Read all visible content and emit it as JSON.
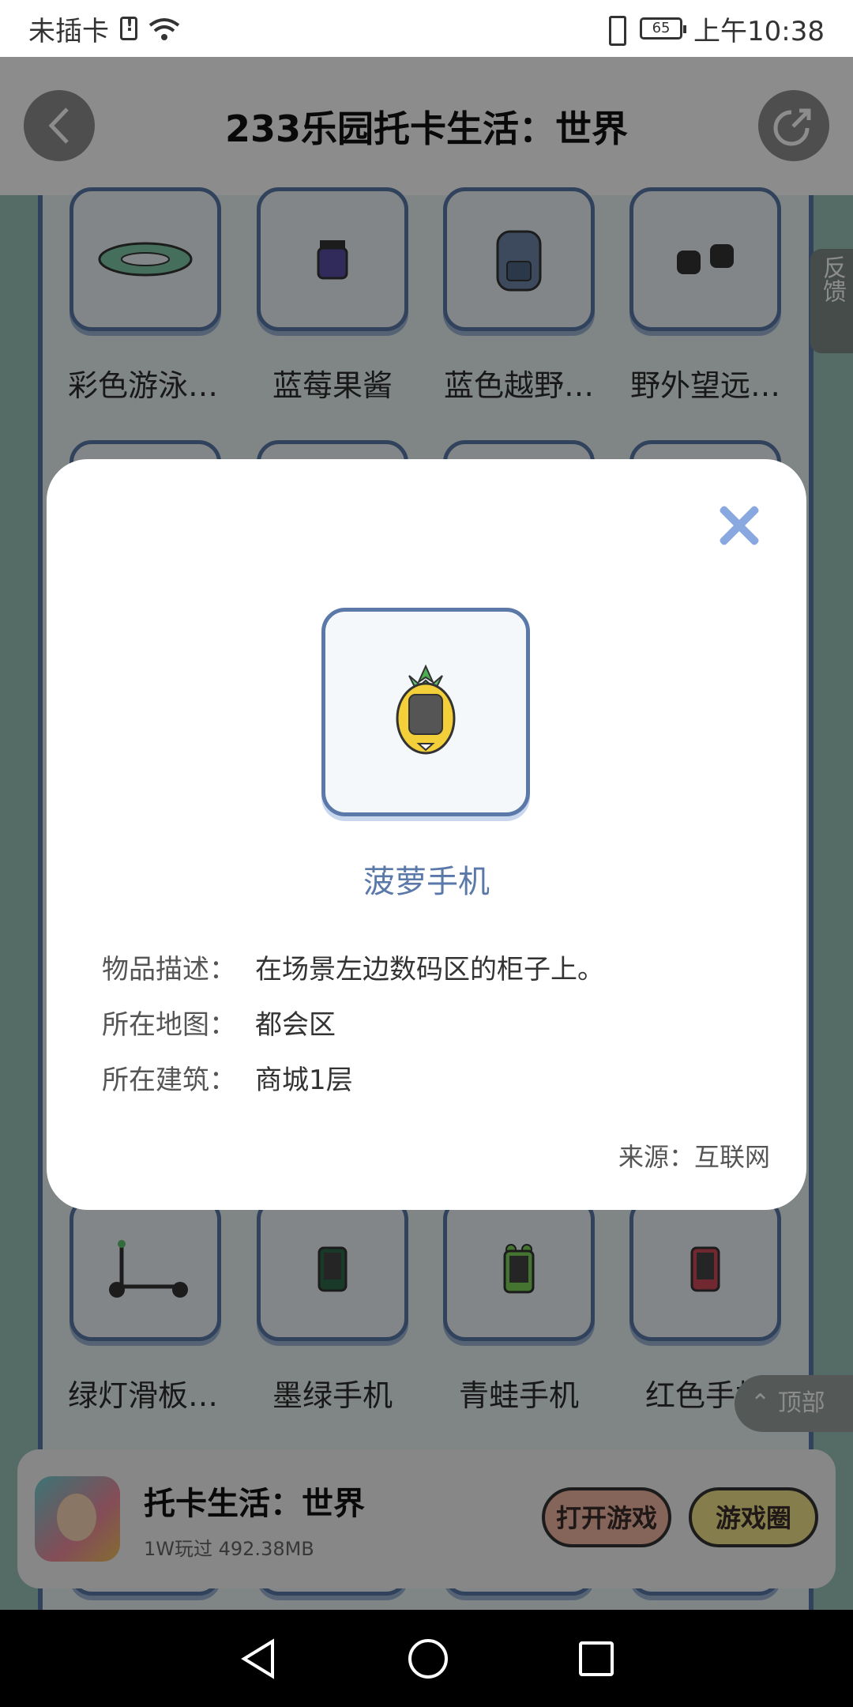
{
  "status_bar": {
    "carrier": "未插卡",
    "battery": "65",
    "time": "上午10:38"
  },
  "header": {
    "title": "233乐园托卡生活：世界"
  },
  "feedback": "反馈",
  "top_button": "顶部",
  "grid": {
    "row1": [
      "彩色游泳…",
      "蓝莓果酱",
      "蓝色越野…",
      "野外望远…"
    ],
    "row3": [
      "绿灯滑板…",
      "墨绿手机",
      "青蛙手机",
      "红色手机"
    ]
  },
  "modal": {
    "item_name": "菠萝手机",
    "rows": [
      {
        "label": "物品描述：",
        "value": "在场景左边数码区的柜子上。"
      },
      {
        "label": "所在地图：",
        "value": "都会区"
      },
      {
        "label": "所在建筑：",
        "value": "商城1层"
      }
    ],
    "source": "来源：互联网"
  },
  "game_bar": {
    "name": "托卡生活：世界",
    "meta": "1W玩过 492.38MB",
    "open_button": "打开游戏",
    "circle_button": "游戏圈"
  },
  "colors": {
    "accent": "#5a78a8",
    "close": "#8aa8e0"
  }
}
